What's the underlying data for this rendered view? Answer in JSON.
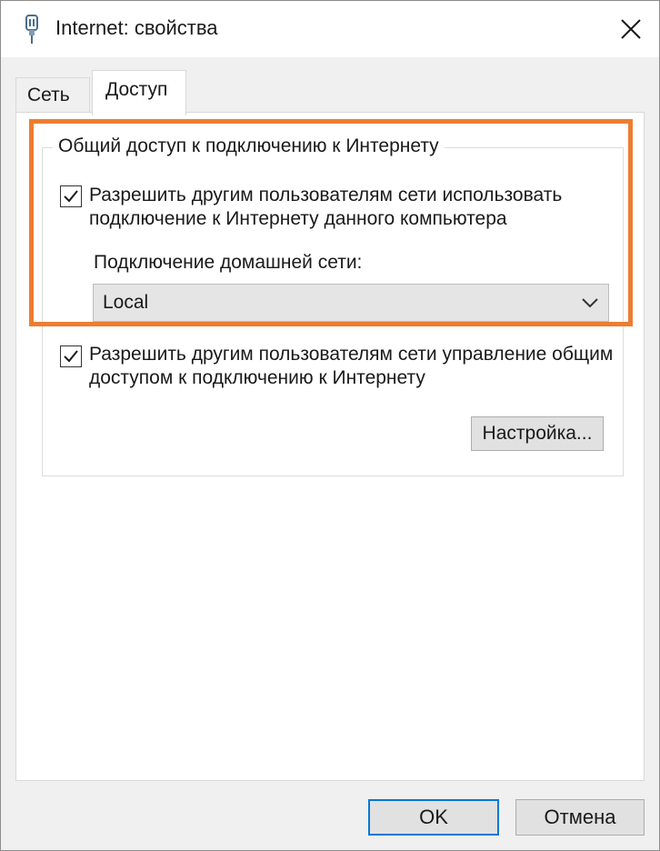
{
  "window": {
    "title": "Internet: свойства"
  },
  "tabs": [
    {
      "label": "Сеть",
      "selected": false
    },
    {
      "label": "Доступ",
      "selected": true
    }
  ],
  "sharing": {
    "group_label": "Общий доступ к подключению к Интернету",
    "allow_use": {
      "checked": true,
      "label": "Разрешить другим пользователям сети использовать подключение к Интернету данного компьютера"
    },
    "home_network_label": "Подключение домашней сети:",
    "home_network_value": "Local",
    "allow_control": {
      "checked": true,
      "label": "Разрешить другим пользователям сети управление общим доступом к подключению к Интернету"
    },
    "settings_button": "Настройка..."
  },
  "buttons": {
    "ok": "OK",
    "cancel": "Отмена"
  },
  "colors": {
    "highlight": "#ed7d31",
    "ok_border": "#0078d7"
  },
  "icons": {
    "title": "network-connection-icon",
    "close": "close-icon"
  }
}
